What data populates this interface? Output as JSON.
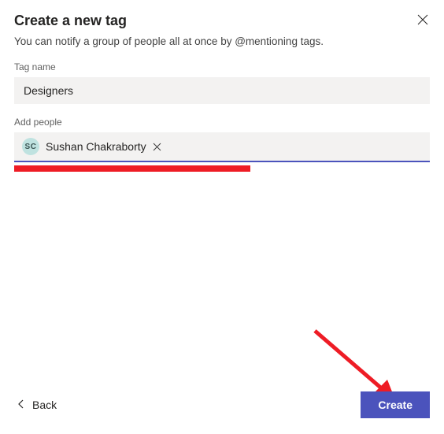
{
  "dialog": {
    "title": "Create a new tag",
    "subtitle": "You can notify a group of people all at once by @mentioning tags."
  },
  "fields": {
    "tag_name_label": "Tag name",
    "tag_name_value": "Designers",
    "add_people_label": "Add people"
  },
  "people": {
    "selected": {
      "initials": "SC",
      "name": "Sushan Chakraborty"
    }
  },
  "footer": {
    "back_label": "Back",
    "create_label": "Create"
  },
  "annotation": {
    "red_bar": true,
    "arrow_color": "#ee1c25"
  }
}
